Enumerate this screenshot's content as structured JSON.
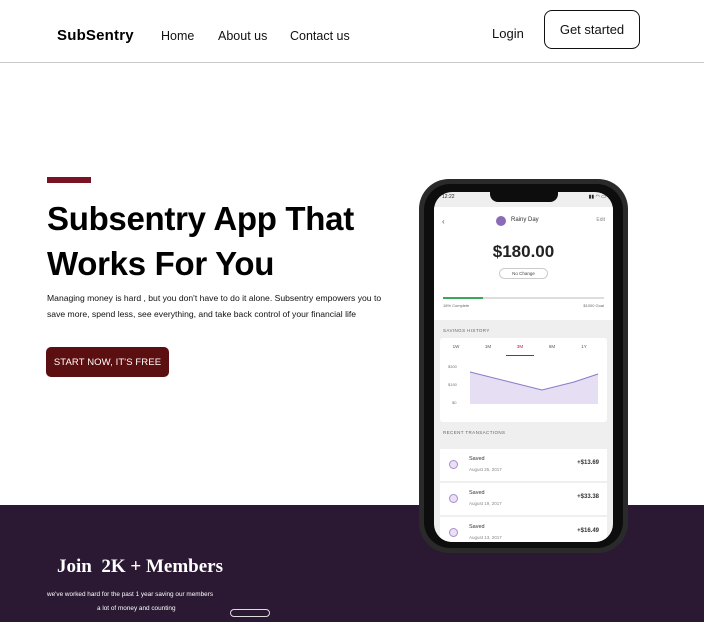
{
  "nav": {
    "logo": "SubSentry",
    "links": [
      "Home",
      "About us",
      "Contact us"
    ],
    "login": "Login",
    "get_started": "Get started"
  },
  "hero": {
    "title": "Subsentry App That Works For You",
    "description": "Managing money is hard , but you don't have to do it alone. Subsentry empowers you to save more, spend less, see everything, and take back control of your financial life",
    "cta": "START NOW, IT'S FREE",
    "accent_color": "#7a1323",
    "cta_color": "#5c0f10"
  },
  "band": {
    "headline": "Join  2K + Members",
    "line1": "we've worked hard for the past 1 year saving our members",
    "line2": "a lot of money and counting",
    "background_color": "#2b1833"
  },
  "phone": {
    "time": "12:22",
    "screen_title": "Rainy Day",
    "edit_label": "Edit",
    "amount": "$180.00",
    "change_label": "No Change",
    "progress_left": "18% Complete",
    "progress_right": "$1000 Goal",
    "progress_fraction": 0.25,
    "savings_history_label": "SAVINGS HISTORY",
    "chart_tabs": [
      "1W",
      "1M",
      "3M",
      "6M",
      "1Y"
    ],
    "chart_active_tab": 2,
    "chart_y_labels": [
      "$300",
      "$150",
      "$0"
    ],
    "recent_label": "RECENT TRANSACTIONS",
    "transactions": [
      {
        "title": "Saved",
        "date": "August 25, 2017",
        "amount": "+$13.69"
      },
      {
        "title": "Saved",
        "date": "August 19, 2017",
        "amount": "+$33.38"
      },
      {
        "title": "Saved",
        "date": "August 13, 2017",
        "amount": "+$16.49"
      }
    ]
  }
}
